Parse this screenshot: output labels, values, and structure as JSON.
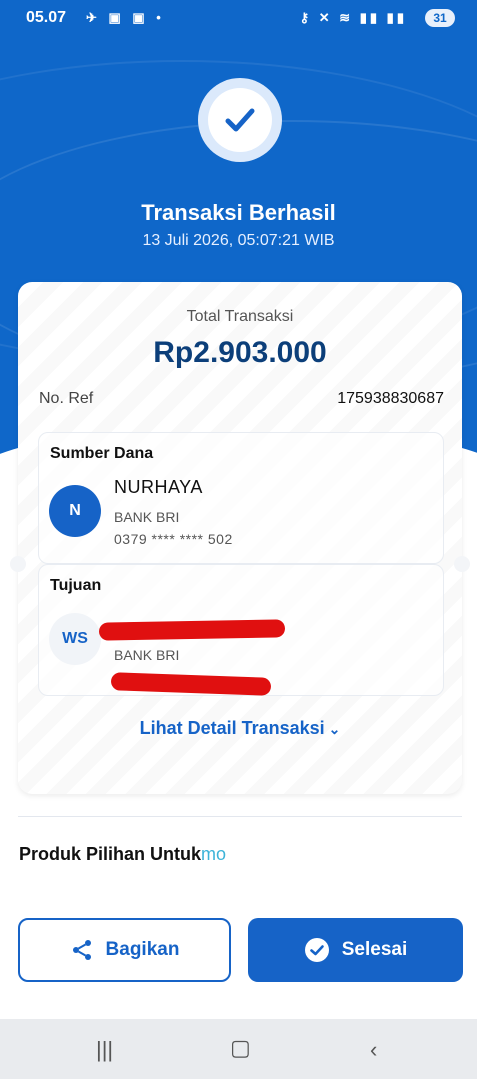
{
  "status_bar": {
    "time": "05.07",
    "left_icons": [
      "notification-icon",
      "bri-icon",
      "bri-icon",
      "dot-icon"
    ],
    "battery": "31"
  },
  "header": {
    "title": "Transaksi Berhasil",
    "datetime": "13 Juli 2026, 05:07:21 WIB"
  },
  "receipt": {
    "total_label": "Total Transaksi",
    "total_amount": "Rp2.903.000",
    "ref_label": "No. Ref",
    "ref_value": "175938830687",
    "source": {
      "title": "Sumber Dana",
      "avatar": "N",
      "name": "NURHAYA",
      "bank": "BANK BRI",
      "account": "0379 **** **** 502"
    },
    "destination": {
      "title": "Tujuan",
      "avatar": "WS",
      "bank": "BANK BRI"
    },
    "detail_link": "Lihat Detail Transaksi"
  },
  "produk": {
    "label": "Produk Pilihan Untuk",
    "logo": "mo"
  },
  "buttons": {
    "share": "Bagikan",
    "done": "Selesai"
  },
  "colors": {
    "primary": "#1663c7",
    "header_bg": "#0f67c9",
    "amount": "#0c3f7a",
    "redaction": "#e01010"
  }
}
